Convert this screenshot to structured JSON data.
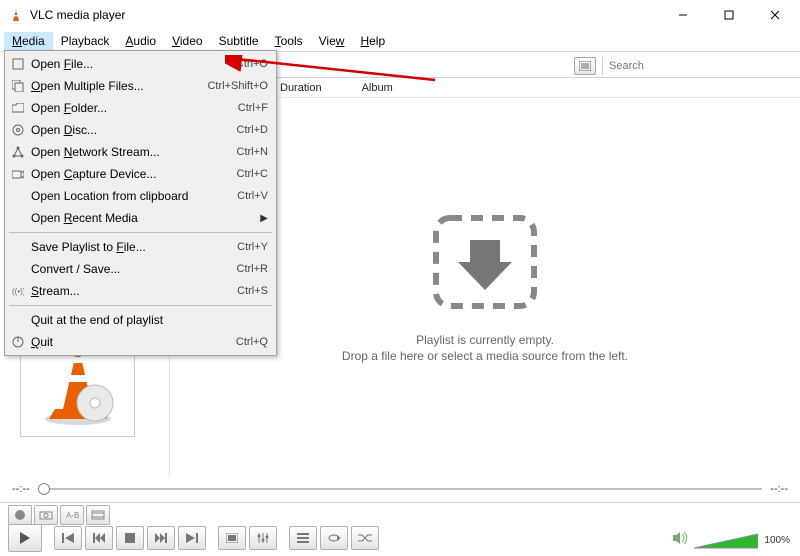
{
  "window": {
    "title": "VLC media player"
  },
  "menubar": {
    "items": [
      {
        "label": "Media",
        "ul": "M",
        "open": true
      },
      {
        "label": "Playback",
        "ul": ""
      },
      {
        "label": "Audio",
        "ul": "A"
      },
      {
        "label": "Video",
        "ul": "V"
      },
      {
        "label": "Subtitle",
        "ul": ""
      },
      {
        "label": "Tools",
        "ul": "T"
      },
      {
        "label": "Vie",
        "ul": "w"
      },
      {
        "label": "Help",
        "ul": "H"
      }
    ]
  },
  "dropdown": {
    "items": [
      {
        "icon": "file",
        "label": "Open File...",
        "ul": "F",
        "shortcut": "Ctrl+O",
        "highlighted": true
      },
      {
        "icon": "files",
        "label": "Open Multiple Files...",
        "ul": "O",
        "shortcut": "Ctrl+Shift+O"
      },
      {
        "icon": "folder",
        "label": "Open Folder...",
        "ul": "F",
        "after": "older...",
        "shortcut": "Ctrl+F"
      },
      {
        "icon": "disc",
        "label": "Open Disc...",
        "ul": "D",
        "shortcut": "Ctrl+D"
      },
      {
        "icon": "network",
        "label": "Open Network Stream...",
        "ul": "N",
        "shortcut": "Ctrl+N"
      },
      {
        "icon": "capture",
        "label": "Open Capture Device...",
        "ul": "C",
        "shortcut": "Ctrl+C"
      },
      {
        "icon": "",
        "label": "Open Location from clipboard",
        "shortcut": "Ctrl+V"
      },
      {
        "icon": "",
        "label": "Open Recent Media",
        "ul": "R",
        "shortcut": "",
        "submenu": true
      },
      {
        "sep": true
      },
      {
        "icon": "",
        "label": "Save Playlist to File...",
        "ul": "F",
        "shortcut": "Ctrl+Y"
      },
      {
        "icon": "",
        "label": "Convert / Save...",
        "ul": "",
        "shortcut": "Ctrl+R"
      },
      {
        "icon": "stream",
        "label": "Stream...",
        "ul": "S",
        "shortcut": "Ctrl+S"
      },
      {
        "sep": true
      },
      {
        "icon": "",
        "label": "Quit at the end of playlist",
        "shortcut": ""
      },
      {
        "icon": "quit",
        "label": "Quit",
        "ul": "Q",
        "shortcut": "Ctrl+Q"
      }
    ]
  },
  "search": {
    "placeholder": "Search"
  },
  "columns": {
    "c1": "Duration",
    "c2": "Album"
  },
  "empty": {
    "line1": "Playlist is currently empty.",
    "line2": "Drop a file here or select a media source from the left."
  },
  "time": {
    "current": "--:--",
    "total": "--:--"
  },
  "volume": {
    "percent": "100%"
  }
}
